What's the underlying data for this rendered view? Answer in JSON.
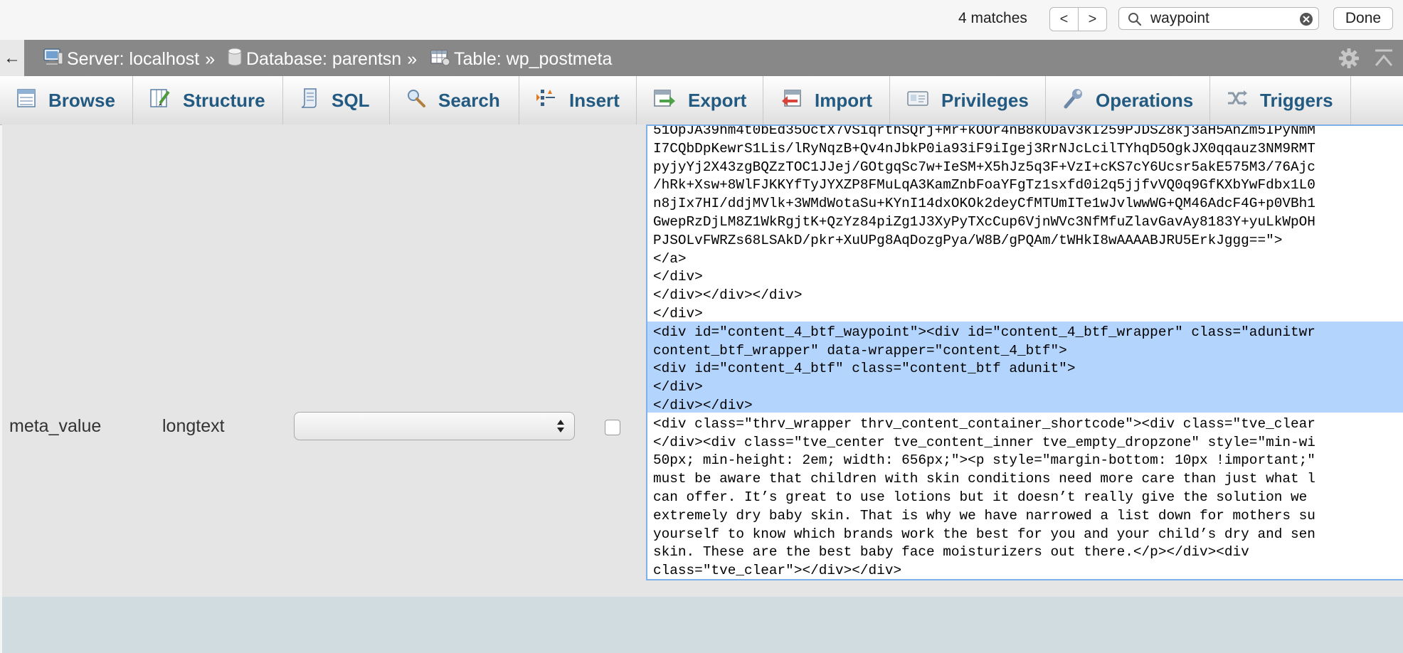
{
  "find_bar": {
    "match_count": "4 matches",
    "prev_label": "<",
    "next_label": ">",
    "query": "waypoint",
    "done_label": "Done",
    "icons": [
      "search-icon",
      "clear-icon"
    ]
  },
  "breadcrumb": {
    "back_label": "←",
    "server": "Server: localhost",
    "database": "Database: parentsn",
    "table": "Table: wp_postmeta",
    "separator": "»",
    "icons": [
      "server-icon",
      "database-icon",
      "table-icon",
      "gear-icon",
      "collapse-icon"
    ]
  },
  "tabs": [
    {
      "label": "Browse",
      "icon": "browse-icon"
    },
    {
      "label": "Structure",
      "icon": "structure-icon"
    },
    {
      "label": "SQL",
      "icon": "sql-icon"
    },
    {
      "label": "Search",
      "icon": "search-icon"
    },
    {
      "label": "Insert",
      "icon": "insert-icon"
    },
    {
      "label": "Export",
      "icon": "export-icon"
    },
    {
      "label": "Import",
      "icon": "import-icon"
    },
    {
      "label": "Privileges",
      "icon": "privileges-icon"
    },
    {
      "label": "Operations",
      "icon": "operations-icon"
    },
    {
      "label": "Triggers",
      "icon": "triggers-icon"
    }
  ],
  "row": {
    "column_name": "meta_value",
    "type": "longtext",
    "function_value": ""
  },
  "value_lines": [
    "51OpJA39hm4t0bEd35OctX7VSiqrthSQrj+Mr+kOOr4nB8kODav3kI259PJDSZ8kj3aH5AnZm5IPyNmM",
    "I7CQbDpKewrS1Lis/lRyNqzB+Qv4nJbkP0ia93iF9iIgej3RrNJcLcilTYhqD5OgkJX0qqauz3NM9RMT",
    "pyjyYj2X43zgBQZzTOC1JJej/GOtgqSc7w+IeSM+X5hJz5q3F+VzI+cKS7cY6Ucsr5akE575M3/76Ajc",
    "/hRk+Xsw+8WlFJKKYfTyJYXZP8FMuLqA3KamZnbFoaYFgTz1sxfd0i2q5jjfvVQ0q9GfKXbYwFdbx1L0",
    "n8jIx7HI/ddjMVlk+3WMdWotaSu+KYnI14dxOKOk2deyCfMTUmITe1wJvlwwWG+QM46AdcF4G+p0VBh1",
    "GwepRzDjLM8Z1WkRgjtK+QzYz84piZg1J3XyPyTXcCup6VjnWVc3NfMfuZlavGavAy8183Y+yuLkWpOH",
    "PJSOLvFWRZs68LSAkD/pkr+XuUPg8AqDozgPya/W8B/gPQAm/tWHkI8wAAAABJRU5ErkJggg==\">",
    "</a>",
    "</div>",
    "</div></div></div>",
    "</div>",
    "<div id=\"content_4_btf_waypoint\"><div id=\"content_4_btf_wrapper\" class=\"adunitwr",
    "content_btf_wrapper\" data-wrapper=\"content_4_btf\">",
    "<div id=\"content_4_btf\" class=\"content_btf adunit\">",
    "</div>",
    "</div></div>",
    "<div class=\"thrv_wrapper thrv_content_container_shortcode\"><div class=\"tve_clear",
    "</div><div class=\"tve_center tve_content_inner tve_empty_dropzone\" style=\"min-wi",
    "50px; min-height: 2em; width: 656px;\"><p style=\"margin-bottom: 10px !important;\"",
    "must be aware that children with skin conditions need more care than just what l",
    "can offer. It’s great to use lotions but it doesn’t really give the solution we",
    "extremely dry baby skin. That is why we have narrowed a list down for mothers su",
    "yourself to know which brands work the best for you and your child’s dry and sen",
    "skin. These are the best baby face moisturizers out there.</p></div><div",
    "class=\"tve_clear\"></div></div>"
  ],
  "colors": {
    "breadcrumb_bg": "#888888",
    "tab_text": "#235a81",
    "selection": "#b3d4fd",
    "footer_bg": "#d0dce0"
  }
}
